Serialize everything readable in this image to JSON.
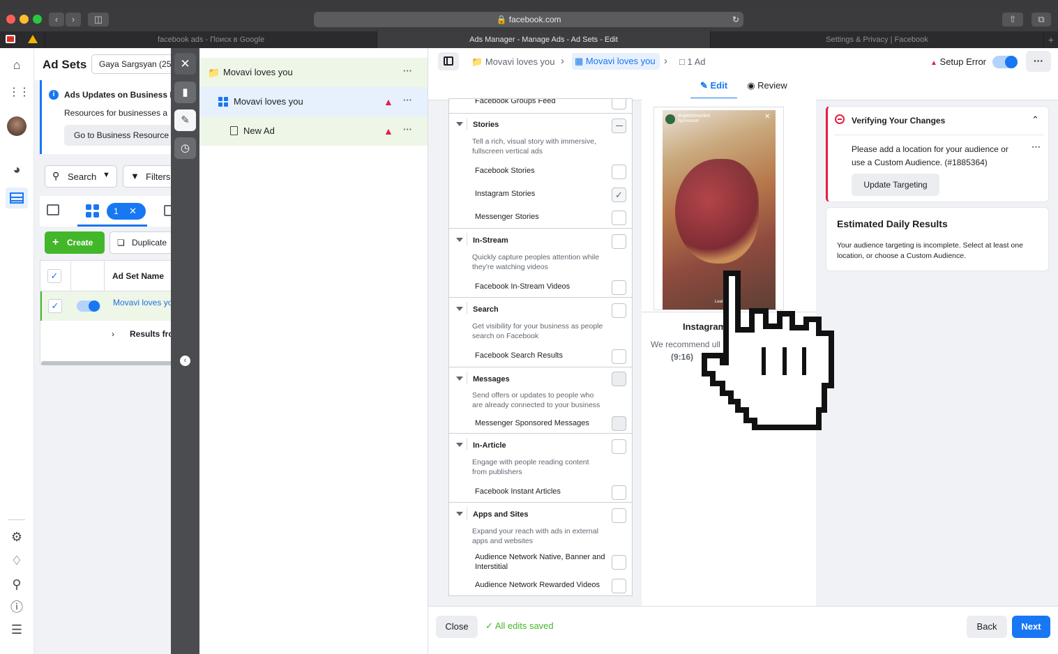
{
  "browser": {
    "url": "facebook.com",
    "tabs": [
      {
        "label": "facebook ads - Поиск в Google",
        "active": false
      },
      {
        "label": "Ads Manager - Manage Ads - Ad Sets - Edit",
        "active": true
      },
      {
        "label": "Settings & Privacy | Facebook",
        "active": false
      }
    ],
    "new_tab_glyph": "+"
  },
  "left_pane": {
    "title": "Ad Sets",
    "account": "Gaya Sargsyan (25",
    "notice_title": "Ads Updates on Business I",
    "notice_body": "Resources for businesses a",
    "notice_button": "Go to Business Resource",
    "search_label": "Search",
    "filters_label": "Filters",
    "selected_count": "1",
    "create_label": "Create",
    "duplicate_label": "Duplicate",
    "column_header": "Ad Set Name",
    "row_name": "Movavi loves yo",
    "results_label": "Results fro"
  },
  "tree": {
    "campaign": "Movavi loves you",
    "adset": "Movavi loves you",
    "ad": "New Ad",
    "more_glyph": "···"
  },
  "topbar": {
    "crumb_campaign": "Movavi loves you",
    "crumb_adset": "Movavi loves you",
    "crumb_ad": "1 Ad",
    "setup_error": "Setup Error",
    "more_glyph": "···"
  },
  "edit_tabs": {
    "edit": "Edit",
    "review": "Review"
  },
  "placements": {
    "top_item": "Facebook Groups Feed",
    "sections": [
      {
        "title": "Stories",
        "desc": "Tell a rich, visual story with immersive, fullscreen vertical ads",
        "items": [
          "Facebook Stories",
          "Instagram Stories",
          "Messenger Stories"
        ]
      },
      {
        "title": "In-Stream",
        "desc": "Quickly capture peoples attention while they're watching videos",
        "items": [
          "Facebook In-Stream Videos"
        ]
      },
      {
        "title": "Search",
        "desc": "Get visibility for your business as people search on Facebook",
        "items": [
          "Facebook Search Results"
        ]
      },
      {
        "title": "Messages",
        "desc": "Send offers or updates to people who are already connected to your business",
        "items": [
          "Messenger Sponsored Messages"
        ]
      },
      {
        "title": "In-Article",
        "desc": "Engage with people reading content from publishers",
        "items": [
          "Facebook Instant Articles"
        ]
      },
      {
        "title": "Apps and Sites",
        "desc": "Expand your reach with ads in external apps and websites",
        "items": [
          "Audience Network Native, Banner and Interstitial",
          "Audience Network Rewarded Videos"
        ]
      }
    ]
  },
  "preview": {
    "label": "Instagram",
    "note": "We recommend ull",
    "ratio": "(9:16)",
    "account": "lesportsmarket",
    "sponsored": "Sponsored",
    "learn": "Learn"
  },
  "verify": {
    "title": "Verifying Your Changes",
    "message": "Please add a location for your audience or use a Custom Audience. (#1885364)",
    "button": "Update Targeting"
  },
  "estimate": {
    "title": "Estimated Daily Results",
    "body": "Your audience targeting is incomplete. Select at least one location, or choose a Custom Audience."
  },
  "footer": {
    "close": "Close",
    "saved": "All edits saved",
    "back": "Back",
    "next": "Next"
  },
  "colors": {
    "brand_blue": "#1877f2",
    "error_red": "#e41e3f",
    "success_green": "#42b72a"
  }
}
